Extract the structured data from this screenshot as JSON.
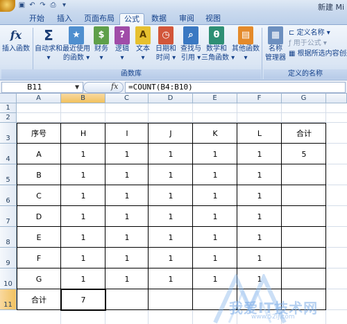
{
  "window": {
    "title": "新建 Mi",
    "accent": "#15428b"
  },
  "quick_access": {
    "save_icon": "save-icon",
    "undo_icon": "undo-icon",
    "redo_icon": "redo-icon",
    "print_icon": "print-icon"
  },
  "tabs": [
    {
      "label": "开始"
    },
    {
      "label": "插入"
    },
    {
      "label": "页面布局"
    },
    {
      "label": "公式"
    },
    {
      "label": "数据"
    },
    {
      "label": "审阅"
    },
    {
      "label": "视图"
    }
  ],
  "active_tab": "公式",
  "ribbon": {
    "function_library": {
      "label": "函数库",
      "buttons": [
        {
          "label1": "插入函数",
          "label2": "",
          "icon": "fx-icon"
        },
        {
          "label1": "自动求和",
          "label2": "▾",
          "icon": "sigma-icon"
        },
        {
          "label1": "最近使用",
          "label2": "的函数 ▾",
          "icon": "recent-icon"
        },
        {
          "label1": "财务",
          "label2": "▾",
          "icon": "financial-icon"
        },
        {
          "label1": "逻辑",
          "label2": "▾",
          "icon": "logical-icon"
        },
        {
          "label1": "文本",
          "label2": "▾",
          "icon": "text-icon"
        },
        {
          "label1": "日期和",
          "label2": "时间 ▾",
          "icon": "datetime-icon"
        },
        {
          "label1": "查找与",
          "label2": "引用 ▾",
          "icon": "lookup-icon"
        },
        {
          "label1": "数学和",
          "label2": "三角函数 ▾",
          "icon": "math-icon"
        },
        {
          "label1": "其他函数",
          "label2": "▾",
          "icon": "more-functions-icon"
        }
      ]
    },
    "defined_names": {
      "label": "定义的名称",
      "name_manager1": "名称",
      "name_manager2": "管理器",
      "define_name": "定义名称 ▾",
      "use_in_formula": "用于公式 ▾",
      "create_from_selection": "根据所选内容创建"
    }
  },
  "formula_bar": {
    "name_box": "B11",
    "fx": "fx",
    "formula": "=COUNT(B4:B10)"
  },
  "sheet": {
    "columns": [
      "A",
      "B",
      "C",
      "D",
      "E",
      "F",
      "G"
    ],
    "selected_column": "B",
    "rows": [
      "1",
      "2",
      "3",
      "4",
      "5",
      "6",
      "7",
      "8",
      "9",
      "10",
      "11"
    ],
    "selected_row": "11",
    "table": {
      "header": [
        "序号",
        "H",
        "I",
        "J",
        "K",
        "L",
        "合计"
      ],
      "body": [
        [
          "A",
          "1",
          "1",
          "1",
          "1",
          "1",
          "5"
        ],
        [
          "B",
          "1",
          "1",
          "1",
          "1",
          "1",
          ""
        ],
        [
          "C",
          "1",
          "1",
          "1",
          "1",
          "1",
          ""
        ],
        [
          "D",
          "1",
          "1",
          "1",
          "1",
          "1",
          ""
        ],
        [
          "E",
          "1",
          "1",
          "1",
          "1",
          "1",
          ""
        ],
        [
          "F",
          "1",
          "1",
          "1",
          "1",
          "1",
          ""
        ],
        [
          "G",
          "1",
          "1",
          "1",
          "1",
          "1",
          ""
        ]
      ],
      "total": [
        "合计",
        "7",
        "",
        "",
        "",
        "",
        ""
      ]
    }
  },
  "watermark": {
    "text": "我爱IT技术网",
    "url": "www.52ij.com"
  }
}
